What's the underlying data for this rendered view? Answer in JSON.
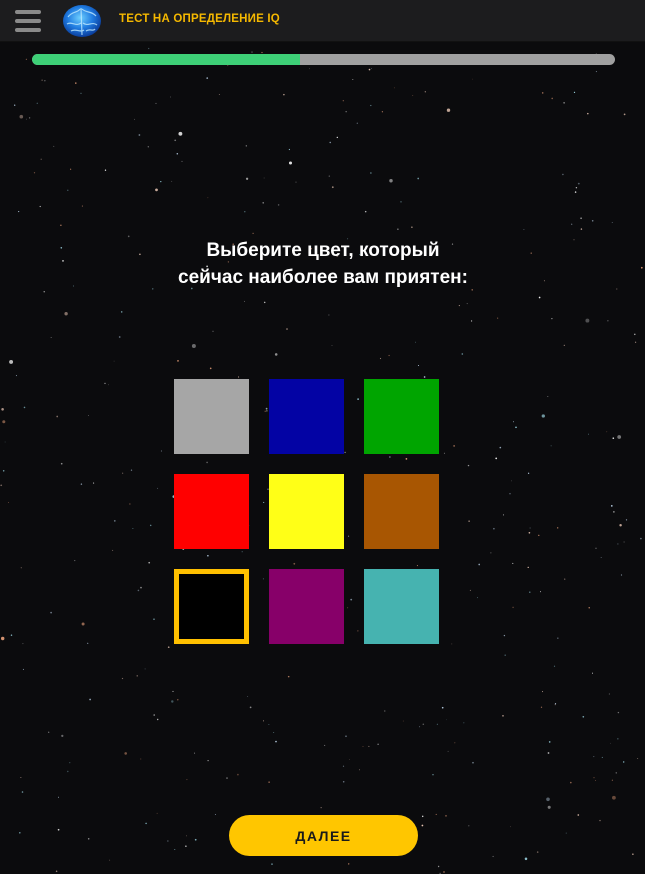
{
  "header": {
    "menu_icon": "hamburger-menu-icon",
    "logo_icon": "brain-logo-icon",
    "title": "ТЕСТ НА ОПРЕДЕЛЕНИЕ IQ",
    "title_color": "#f5b800",
    "background": "#1c1c1e"
  },
  "progress": {
    "value": 0.46,
    "fill_color": "#3ed077",
    "track_color": "#a0a0a0"
  },
  "question": {
    "text": "Выберите цвет, который сейчас наиболее вам приятен:"
  },
  "swatches": [
    {
      "name": "gray",
      "color": "#a6a6a6",
      "selected": false
    },
    {
      "name": "blue",
      "color": "#0303a4",
      "selected": false
    },
    {
      "name": "green",
      "color": "#00a500",
      "selected": false
    },
    {
      "name": "red",
      "color": "#ff0000",
      "selected": false
    },
    {
      "name": "yellow",
      "color": "#ffff17",
      "selected": false
    },
    {
      "name": "brown",
      "color": "#a85602",
      "selected": false
    },
    {
      "name": "black",
      "color": "#000000",
      "selected": true
    },
    {
      "name": "purple",
      "color": "#870069",
      "selected": false
    },
    {
      "name": "teal",
      "color": "#46b3b0",
      "selected": false
    }
  ],
  "selection_color": "#ffc000",
  "next_button": {
    "label": "ДАЛЕЕ",
    "color": "#ffc600"
  }
}
